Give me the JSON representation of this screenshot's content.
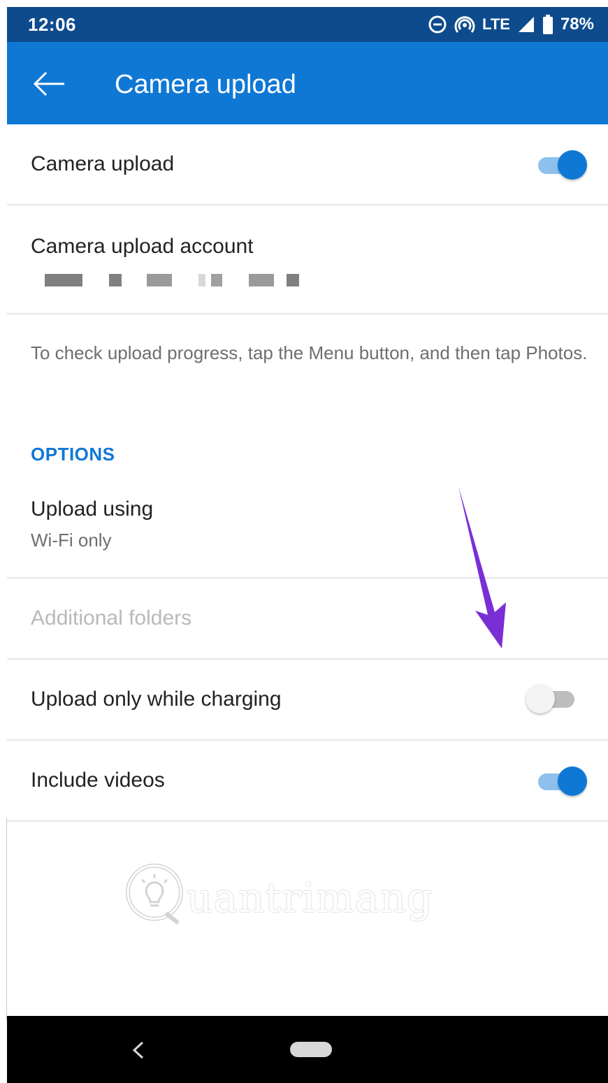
{
  "status_bar": {
    "time": "12:06",
    "network": "LTE",
    "battery": "78%",
    "icons": [
      "do-not-disturb-icon",
      "hotspot-icon",
      "signal-icon",
      "battery-icon"
    ]
  },
  "app_bar": {
    "title": "Camera upload",
    "back_icon": "back-arrow-icon"
  },
  "settings": {
    "camera_upload": {
      "label": "Camera upload",
      "enabled": true
    },
    "account": {
      "label": "Camera upload account",
      "value_redacted": true
    },
    "info": "To check upload progress, tap the Menu button, and then tap Photos.",
    "options_header": "OPTIONS",
    "upload_using": {
      "label": "Upload using",
      "value": "Wi-Fi only"
    },
    "additional_folders": {
      "label": "Additional folders",
      "disabled": true
    },
    "upload_charging": {
      "label": "Upload only while charging",
      "enabled": false
    },
    "include_videos": {
      "label": "Include videos",
      "enabled": true
    }
  },
  "watermark": {
    "text": "uantrimang",
    "icon": "lightbulb-logo-icon"
  },
  "annotation": {
    "icon": "purple-arrow-icon",
    "color": "#7a2fd6"
  },
  "colors": {
    "status_bar": "#0d4b8c",
    "app_bar": "#0f78d4",
    "accent": "#0f78d4"
  },
  "nav_bar": {
    "icons": [
      "nav-back-icon",
      "nav-home-pill-icon"
    ]
  }
}
